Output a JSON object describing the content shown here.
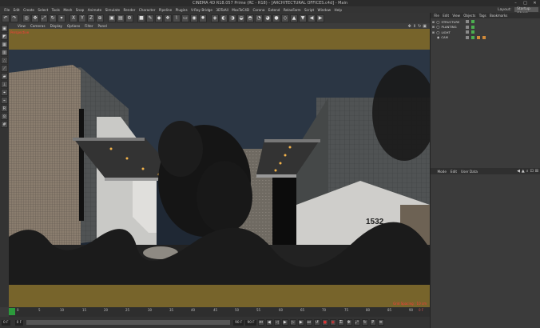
{
  "window": {
    "title": "CINEMA 4D R18.057 Prime (RC - R18) - [ARCHITECTURAL OFFICES.c4d] - Main",
    "controls": [
      "–",
      "□",
      "✕"
    ]
  },
  "menubar": {
    "items": [
      "File",
      "Edit",
      "Create",
      "Select",
      "Tools",
      "Mesh",
      "Snap",
      "Animate",
      "Simulate",
      "Render",
      "Character",
      "Pipeline",
      "Plugins",
      "V-Ray Bridge",
      "3DToAll",
      "MaxToC4D",
      "Corona",
      "Extend",
      "RelaxFarm",
      "Script",
      "Window",
      "Help"
    ],
    "layout_label": "Layout:",
    "layout_value": "Startup (User)"
  },
  "viewport": {
    "menu": [
      "View",
      "Cameras",
      "Display",
      "Options",
      "Filter",
      "Panel"
    ],
    "label_top_left": "Perspective",
    "label_bottom_right": "Grid Spacing : 10 cm",
    "house_number": "1532"
  },
  "timeline": {
    "ticks": [
      "0",
      "5",
      "10",
      "15",
      "20",
      "25",
      "30",
      "35",
      "40",
      "45",
      "50",
      "55",
      "60",
      "65",
      "70",
      "75",
      "80",
      "85",
      "90"
    ],
    "frame_end_label": "0 F"
  },
  "playback": {
    "start": "0 F",
    "current": "0 F",
    "end": "90 F",
    "end2": "90 F"
  },
  "objects_panel": {
    "tabs": [
      "File",
      "Edit",
      "View",
      "Objects",
      "Tags",
      "Bookmarks"
    ],
    "items": [
      {
        "name": "STRUCTURE"
      },
      {
        "name": "PLANTING"
      },
      {
        "name": "LIGHT"
      },
      {
        "name": "CAM"
      }
    ]
  },
  "attributes_panel": {
    "tabs": [
      "Mode",
      "Edit",
      "User Data"
    ]
  },
  "colors": {
    "safe_frame": "#96782a",
    "sky": "#1e2733",
    "accent_green": "#2c9a3c"
  }
}
